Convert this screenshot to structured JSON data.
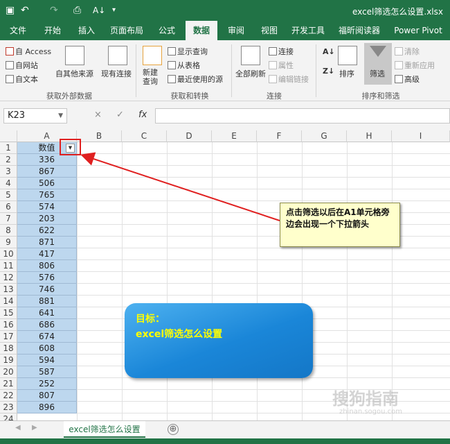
{
  "titlebar": {
    "save_icon": "save-icon",
    "undo_icon": "undo-icon",
    "redo_icon": "redo-icon",
    "preview_icon": "print-preview-icon",
    "sort_icon": "sort-icon",
    "customize_icon": "customize-qat-icon",
    "title": "excel筛选怎么设置.xlsx"
  },
  "tabs": [
    "文件",
    "开始",
    "插入",
    "页面布局",
    "公式",
    "数据",
    "审阅",
    "视图",
    "开发工具",
    "福昕阅读器",
    "Power Pivot"
  ],
  "active_tab": "数据",
  "ribbon": {
    "get_external": {
      "access": "自 Access",
      "web": "自网站",
      "text": "自文本",
      "other": "自其他来源",
      "existing": "现有连接",
      "label": "获取外部数据"
    },
    "get_transform": {
      "new_query": "新建\n查询",
      "show_query": "显示查询",
      "from_table": "从表格",
      "recent": "最近使用的源",
      "label": "获取和转换"
    },
    "connections": {
      "refresh_all": "全部刷新",
      "connections": "连接",
      "properties": "属性",
      "edit_links": "编辑链接",
      "label": "连接"
    },
    "sort_filter": {
      "sort": "排序",
      "filter": "筛选",
      "clear": "清除",
      "reapply": "重新应用",
      "advanced": "高级",
      "label": "排序和筛选"
    }
  },
  "formula_bar": {
    "name_box": "K23",
    "fx": "fx",
    "cancel": "×",
    "enter": "✓",
    "content": ""
  },
  "columns": [
    "A",
    "B",
    "C",
    "D",
    "E",
    "F",
    "G",
    "H",
    "I"
  ],
  "rows": [
    "1",
    "2",
    "3",
    "4",
    "5",
    "6",
    "7",
    "8",
    "9",
    "10",
    "11",
    "12",
    "13",
    "14",
    "15",
    "16",
    "17",
    "18",
    "19",
    "20",
    "21",
    "22",
    "23",
    "24"
  ],
  "cells_a": [
    "数值",
    "336",
    "867",
    "506",
    "765",
    "574",
    "203",
    "622",
    "871",
    "417",
    "806",
    "576",
    "746",
    "881",
    "641",
    "686",
    "674",
    "608",
    "594",
    "587",
    "252",
    "807",
    "896",
    ""
  ],
  "callout": "点击筛选以后在A1单元格旁边会出现一个下拉箭头",
  "goal": {
    "line1": "目标：",
    "line2": "excel筛选怎么设置"
  },
  "watermark": "搜狗指南",
  "watermark_sub": "zhinan.sogou.com",
  "sheet_tab": "excel筛选怎么设置",
  "add_sheet": "⊕",
  "colors": {
    "excel_green": "#217346",
    "selection": "#bdd7ee",
    "callout_bg": "#ffffcc",
    "arrow": "#e02020"
  }
}
